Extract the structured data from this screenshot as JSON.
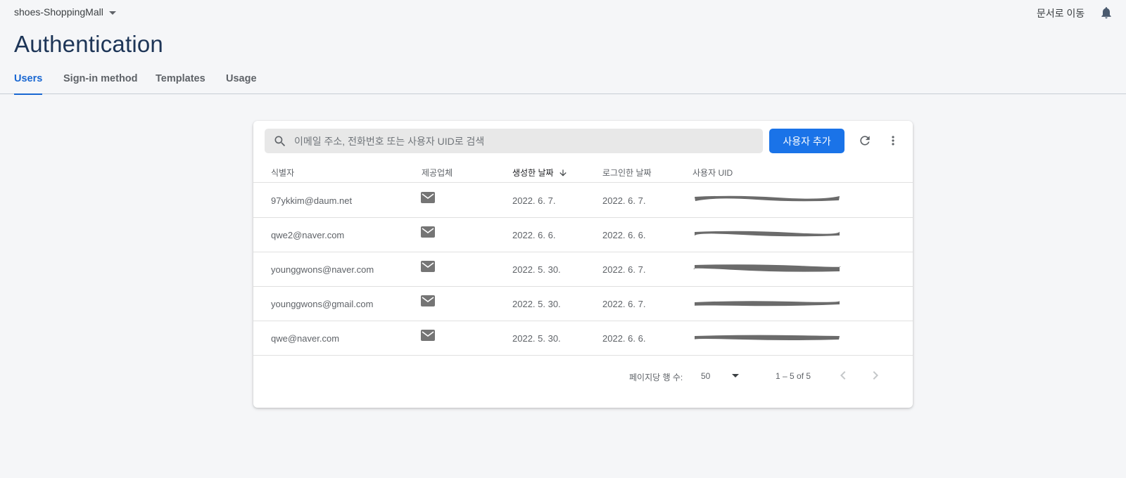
{
  "topbar": {
    "project_name": "shoes-ShoppingMall",
    "docs_link": "문서로 이동"
  },
  "page": {
    "title": "Authentication"
  },
  "tabs": [
    {
      "label": "Users",
      "active": true
    },
    {
      "label": "Sign-in method",
      "active": false
    },
    {
      "label": "Templates",
      "active": false
    },
    {
      "label": "Usage",
      "active": false
    }
  ],
  "toolbar": {
    "search_placeholder": "이메일 주소, 전화번호 또는 사용자 UID로 검색",
    "add_user_label": "사용자 추가"
  },
  "table": {
    "headers": {
      "identifier": "식별자",
      "provider": "제공업체",
      "created": "생성한 날짜",
      "signed_in": "로그인한 날짜",
      "uid": "사용자 UID"
    },
    "rows": [
      {
        "identifier": "97ykkim@daum.net",
        "provider": "email",
        "created": "2022. 6. 7.",
        "signed_in": "2022. 6. 7."
      },
      {
        "identifier": "qwe2@naver.com",
        "provider": "email",
        "created": "2022. 6. 6.",
        "signed_in": "2022. 6. 6."
      },
      {
        "identifier": "younggwons@naver.com",
        "provider": "email",
        "created": "2022. 5. 30.",
        "signed_in": "2022. 6. 7."
      },
      {
        "identifier": "younggwons@gmail.com",
        "provider": "email",
        "created": "2022. 5. 30.",
        "signed_in": "2022. 6. 7."
      },
      {
        "identifier": "qwe@naver.com",
        "provider": "email",
        "created": "2022. 5. 30.",
        "signed_in": "2022. 6. 6."
      }
    ]
  },
  "pagination": {
    "rows_per_page_label": "페이지당 행 수:",
    "rows_per_page": "50",
    "range": "1 – 5 of 5"
  },
  "colors": {
    "accent": "#1a73e8",
    "title": "#1d3557",
    "background": "#f5f6f8"
  }
}
